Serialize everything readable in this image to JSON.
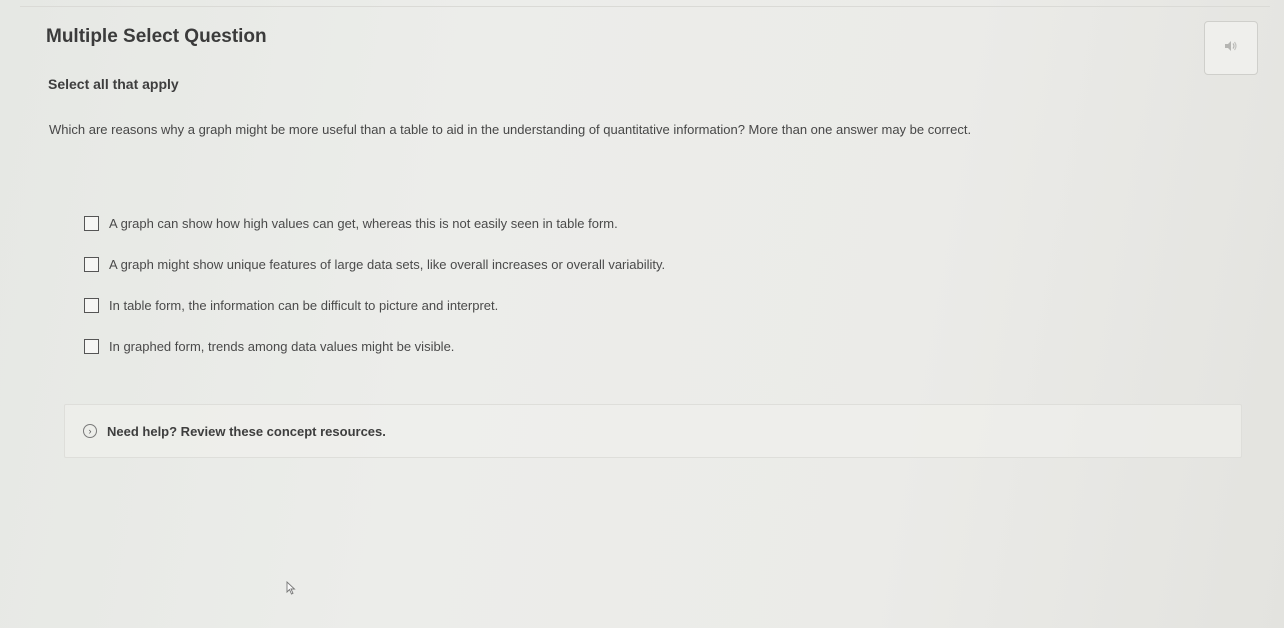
{
  "header": {
    "question_type": "Multiple Select Question",
    "audio_icon": "speaker-icon"
  },
  "question": {
    "instruction": "Select all that apply",
    "prompt": "Which are reasons why a graph might be more useful than a table to aid in the understanding of quantitative information? More than one answer may be correct.",
    "options": [
      {
        "label": "A graph can show how high values can get, whereas this is not easily seen in table form.",
        "checked": false
      },
      {
        "label": "A graph might show unique features of large data sets, like overall increases or overall variability.",
        "checked": false
      },
      {
        "label": "In table form, the information can be difficult to picture and interpret.",
        "checked": false
      },
      {
        "label": "In graphed form, trends among data values might be visible.",
        "checked": false
      }
    ]
  },
  "help": {
    "label": "Need help? Review these concept resources.",
    "icon": "chevron-right-icon"
  },
  "cursor": {
    "icon": "mouse-pointer-icon"
  }
}
